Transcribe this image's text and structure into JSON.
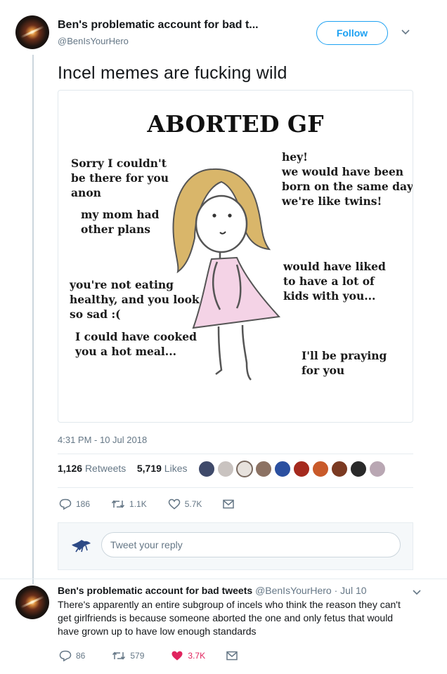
{
  "tweet": {
    "author_name": "Ben's problematic account for bad t...",
    "author_handle": "@BenIsYourHero",
    "follow_label": "Follow",
    "text": "Incel memes are fucking wild",
    "timestamp": "4:31 PM - 10 Jul 2018",
    "retweets_count": "1,126",
    "retweets_label": "Retweets",
    "likes_count": "5,719",
    "likes_label": "Likes",
    "reply_count": "186",
    "retweet_count_short": "1.1K",
    "like_count_short": "5.7K"
  },
  "meme": {
    "title": "ABORTED GF",
    "lines": {
      "sorry": "Sorry I couldn't\nbe there for you\nanon",
      "mom": "my mom had\nother plans",
      "eating": "you're not eating\nhealthy, and you look\nso sad :(",
      "cooked": "I could have cooked\nyou a hot meal...",
      "hey": "hey!\nwe would have been\nborn on the same day\nwe're like twins!",
      "kids": "would have liked\nto have a lot of\nkids with you...",
      "praying": "I'll be praying\nfor you"
    }
  },
  "reply_composer": {
    "placeholder": "Tweet your reply"
  },
  "reply_tweet": {
    "author_name": "Ben's problematic account for bad tweets",
    "author_handle": "@BenIsYourHero",
    "date": "· Jul 10",
    "text": "There's apparently an entire subgroup of incels who think the reason they can't get girlfriends is because someone aborted the one and only fetus that would have grown up to have low enough standards",
    "reply_count": "86",
    "retweet_count": "579",
    "like_count": "3.7K"
  },
  "colors": {
    "accent": "#1da1f2",
    "muted": "#657786",
    "like_red": "#e0245e",
    "hair": "#d9b66a",
    "dress": "#f4d3e6"
  }
}
